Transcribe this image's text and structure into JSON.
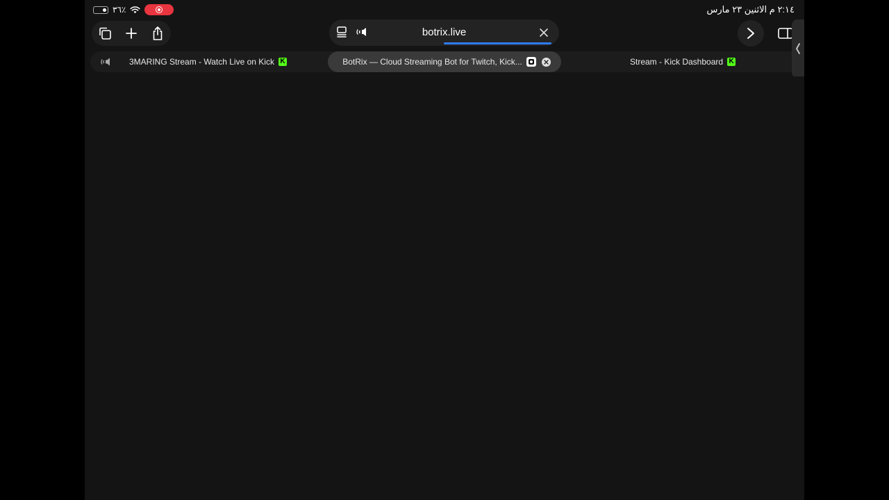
{
  "status_bar": {
    "time_date": "٢:١٤ م  الاثنين ٢٣ مارس",
    "battery_percent": "٣٦٪",
    "recording_color": "#e8353f"
  },
  "toolbar": {
    "tabs_icon": "tabs-overview-icon",
    "new_tab_icon": "plus-icon",
    "share_icon": "share-icon",
    "forward_icon": "chevron-right-icon",
    "sidebar_icon": "sidebar-icon"
  },
  "address_bar": {
    "url": "botrix.live",
    "load_progress": 0.5,
    "accent_color": "#2f7cf6"
  },
  "tabs": [
    {
      "label": "3MARING Stream - Watch Live on Kick",
      "badge": "K",
      "audio": true,
      "active": false
    },
    {
      "label": "BotRix — Cloud Streaming Bot for Twitch, Kick...",
      "active": true
    },
    {
      "label": "Stream - Kick Dashboard",
      "badge": "K",
      "active": false
    }
  ],
  "colors": {
    "kick_green": "#53fc18",
    "page_background": "#141414"
  }
}
